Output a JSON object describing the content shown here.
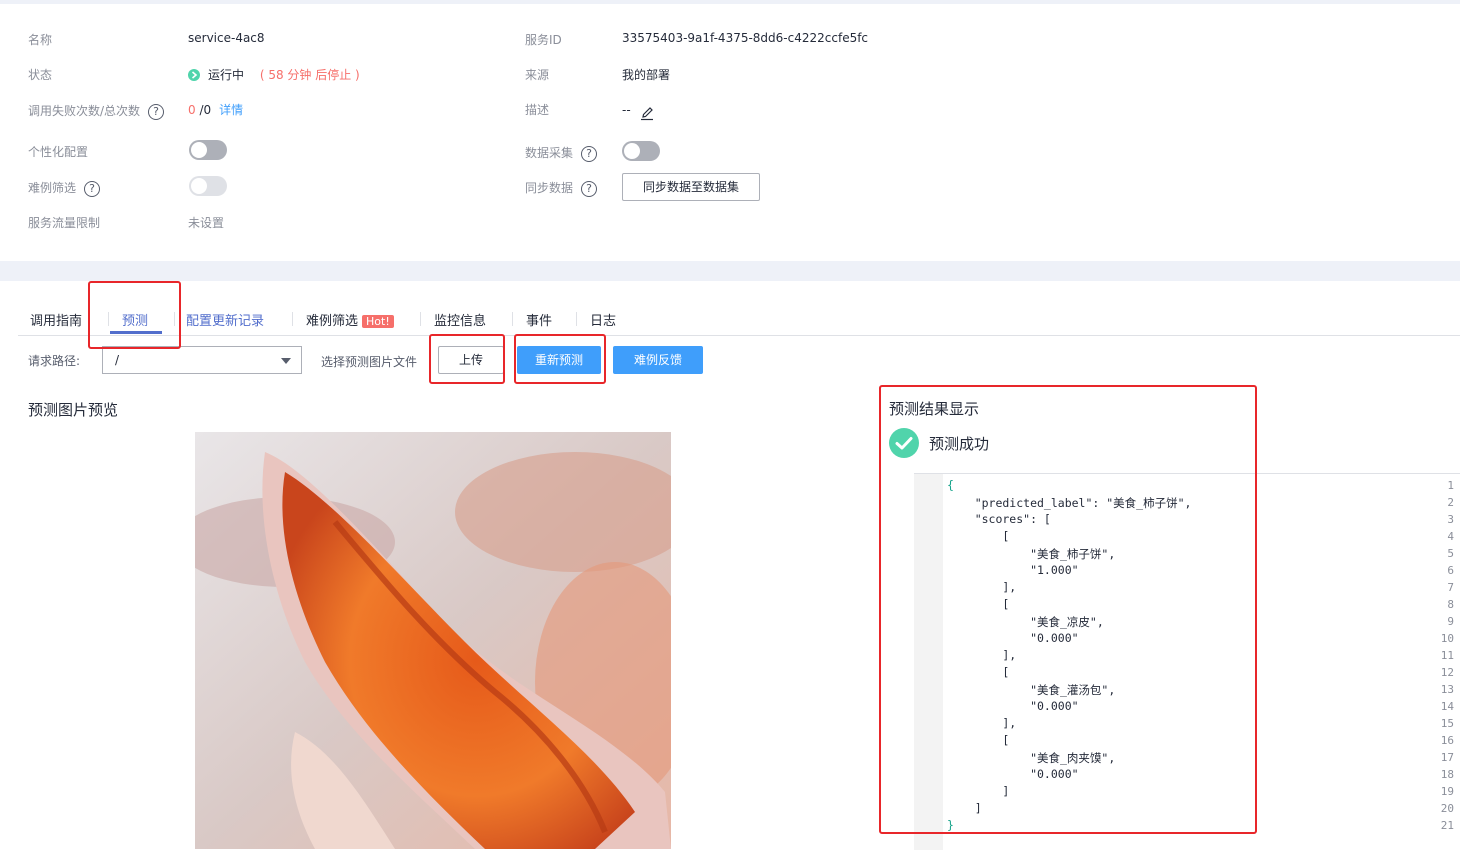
{
  "info": {
    "name_label": "名称",
    "name_value": "service-4ac8",
    "status_label": "状态",
    "status_value": "运行中",
    "status_note": "( 58 分钟 后停止 )",
    "calls_label": "调用失败次数/总次数",
    "calls_fail": "0",
    "calls_total": " /0",
    "calls_detail": "详情",
    "personal_label": "个性化配置",
    "hard_label": "难例筛选",
    "traffic_label": "服务流量限制",
    "traffic_value": "未设置",
    "service_id_label": "服务ID",
    "service_id_value": "33575403-9a1f-4375-8dd6-c4222ccfe5fc",
    "source_label": "来源",
    "source_value": "我的部署",
    "desc_label": "描述",
    "desc_value": "--",
    "collect_label": "数据采集",
    "sync_label": "同步数据",
    "sync_button": "同步数据至数据集",
    "help_glyph": "?"
  },
  "tabs": [
    {
      "label": "调用指南"
    },
    {
      "label": "预测"
    },
    {
      "label": "配置更新记录"
    },
    {
      "label": "难例筛选",
      "badge": "Hot!"
    },
    {
      "label": "监控信息"
    },
    {
      "label": "事件"
    },
    {
      "label": "日志"
    }
  ],
  "toolbar": {
    "path_label": "请求路径:",
    "path_value": "/",
    "choose_label": "选择预测图片文件",
    "upload_button": "上传",
    "repredict_button": "重新预测",
    "feedback_button": "难例反馈"
  },
  "preview_title": "预测图片预览",
  "result": {
    "title": "预测结果显示",
    "status": "预测成功",
    "lines": [
      "{",
      "    \"predicted_label\": \"美食_柿子饼\",",
      "    \"scores\": [",
      "        [",
      "            \"美食_柿子饼\",",
      "            \"1.000\"",
      "        ],",
      "        [",
      "            \"美食_凉皮\",",
      "            \"0.000\"",
      "        ],",
      "        [",
      "            \"美食_灌汤包\",",
      "            \"0.000\"",
      "        ],",
      "        [",
      "            \"美食_肉夹馍\",",
      "            \"0.000\"",
      "        ]",
      "    ]",
      "}"
    ]
  },
  "colors": {
    "accent": "#526ecc",
    "primary_button": "#3f9efb",
    "running": "#50d4ab",
    "warning_note": "#f66f6a",
    "highlight_box": "#e8262a"
  }
}
